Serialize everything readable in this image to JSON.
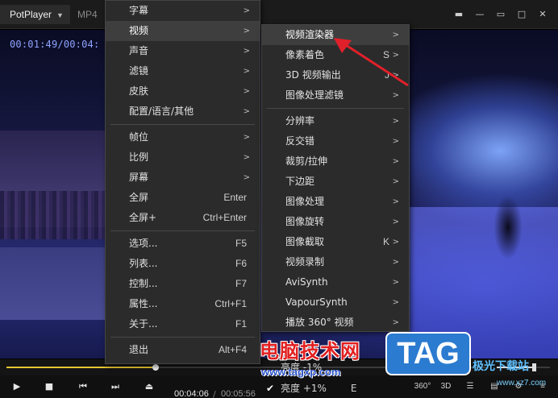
{
  "titlebar": {
    "app_name": "PotPlayer",
    "format_label": "MP4",
    "window_buttons": [
      "pin",
      "minimize",
      "restore",
      "maximize",
      "close"
    ]
  },
  "video": {
    "timecode_overlay": "00:01:49/00:04:"
  },
  "menu_main": {
    "items": [
      {
        "label": "字幕",
        "arrow": ">"
      },
      {
        "label": "视频",
        "arrow": ">",
        "highlighted": true
      },
      {
        "label": "声音",
        "arrow": ">"
      },
      {
        "label": "滤镜",
        "arrow": ">"
      },
      {
        "label": "皮肤",
        "arrow": ">"
      },
      {
        "label": "配置/语言/其他",
        "arrow": ">"
      },
      {
        "label": "帧位",
        "arrow": ">"
      },
      {
        "label": "比例",
        "arrow": ">"
      },
      {
        "label": "屏幕",
        "arrow": ">"
      },
      {
        "label": "全屏",
        "shortcut": "Enter"
      },
      {
        "label": "全屏+",
        "shortcut": "Ctrl+Enter"
      },
      {
        "label": "选项...",
        "shortcut": "F5"
      },
      {
        "label": "列表...",
        "shortcut": "F6"
      },
      {
        "label": "控制...",
        "shortcut": "F7"
      },
      {
        "label": "属性...",
        "shortcut": "Ctrl+F1"
      },
      {
        "label": "关于...",
        "shortcut": "F1"
      },
      {
        "label": "退出",
        "shortcut": "Alt+F4"
      }
    ]
  },
  "menu_video": {
    "items": [
      {
        "label": "视频渲染器",
        "arrow": ">",
        "highlighted": true
      },
      {
        "label": "像素着色",
        "shortcut": "S",
        "arrow": ">"
      },
      {
        "label": "3D 视频输出",
        "shortcut": "J",
        "arrow": ">"
      },
      {
        "label": "图像处理滤镜",
        "arrow": ">"
      },
      {
        "label": "分辨率",
        "arrow": ">"
      },
      {
        "label": "反交错",
        "arrow": ">"
      },
      {
        "label": "裁剪/拉伸",
        "arrow": ">"
      },
      {
        "label": "下边距",
        "arrow": ">"
      },
      {
        "label": "图像处理",
        "arrow": ">"
      },
      {
        "label": "图像旋转",
        "arrow": ">"
      },
      {
        "label": "图像截取",
        "shortcut": "K",
        "arrow": ">"
      },
      {
        "label": "视频录制",
        "arrow": ">"
      },
      {
        "label": "AviSynth",
        "arrow": ">"
      },
      {
        "label": "VapourSynth",
        "arrow": ">"
      },
      {
        "label": "播放 360° 视频",
        "arrow": ">"
      }
    ],
    "partial_items": [
      {
        "label": "亮度 -1%"
      },
      {
        "label": "亮度 +1%",
        "shortcut": "E",
        "checked": true
      }
    ]
  },
  "controls": {
    "seek_progress": 0.31,
    "volume_level": 0.7,
    "current_time": "00:04:06",
    "separator": "/",
    "total_time": "00:05:56",
    "right_buttons": [
      "360°",
      "3D"
    ]
  },
  "watermark": {
    "cn": "电脑技术网",
    "url": "www.tagxp.com",
    "tag": "TAG",
    "download": "极光下载站",
    "url2": "www.xz7.com"
  },
  "colors": {
    "menu_bg": "#2b2b2b",
    "menu_highlight": "#3e3e3e",
    "seek_fill": "#e8c632",
    "arrow_annotation": "#e0202a",
    "timecode": "#8fa3ff"
  }
}
